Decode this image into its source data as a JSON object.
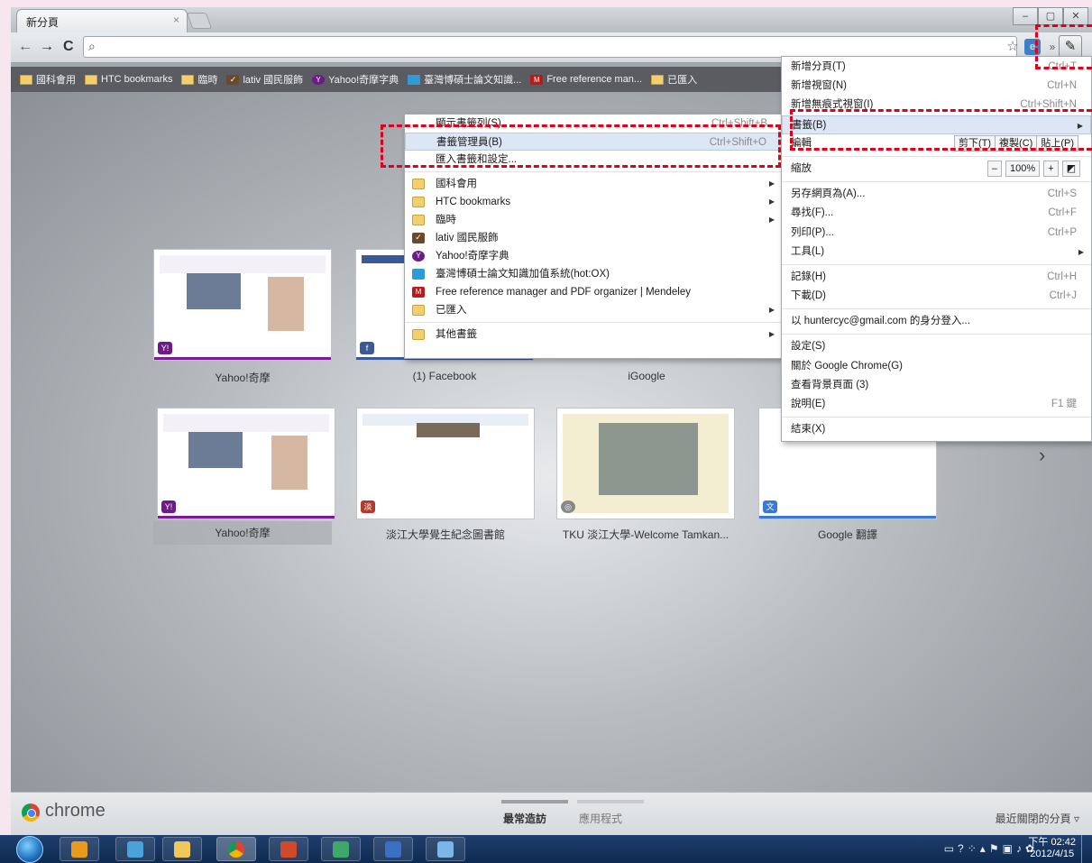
{
  "tab": {
    "title": "新分頁"
  },
  "window_controls": [
    "–",
    "▢",
    "✕"
  ],
  "toolbar": {
    "back_icon": "←",
    "forward_icon": "→",
    "reload_icon": "C",
    "search_icon": "🔍",
    "star_icon": "☆",
    "overflow": "»",
    "wrench_icon": "🔧"
  },
  "bookmarks_bar": [
    {
      "label": "國科會用",
      "icon": "folder"
    },
    {
      "label": "HTC bookmarks",
      "icon": "folder"
    },
    {
      "label": "臨時",
      "icon": "folder"
    },
    {
      "label": "lativ 國民服飾",
      "icon": "check"
    },
    {
      "label": "Yahoo!奇摩字典",
      "icon": "yahoo"
    },
    {
      "label": "臺灣博碩士論文知識...",
      "icon": "thesis"
    },
    {
      "label": "Free reference man...",
      "icon": "mendeley"
    },
    {
      "label": "已匯入",
      "icon": "folder"
    }
  ],
  "thumbnails": {
    "row1": [
      "Yahoo!奇摩",
      "(1) Facebook",
      "iGoogle"
    ],
    "row2": [
      "Yahoo!奇摩",
      "淡江大學覺生紀念圖書館",
      "TKU 淡江大學-Welcome Tamkan...",
      "Google 翻譯"
    ]
  },
  "bottom_bar": {
    "brand": "chrome",
    "most_visited": "最常造訪",
    "apps": "應用程式",
    "recently_closed": "最近關閉的分頁 ▿"
  },
  "bookmarks_submenu": {
    "top": [
      {
        "label": "顯示書籤列(S)",
        "shortcut": "Ctrl+Shift+B"
      },
      {
        "label": "書籤管理員(B)",
        "shortcut": "Ctrl+Shift+O"
      },
      {
        "label": "匯入書籤和設定..."
      }
    ],
    "items": [
      {
        "label": "國科會用",
        "submenu": true,
        "icon": "folder"
      },
      {
        "label": "HTC bookmarks",
        "submenu": true,
        "icon": "folder"
      },
      {
        "label": "臨時",
        "submenu": true,
        "icon": "folder"
      },
      {
        "label": "lativ 國民服飾",
        "icon": "check"
      },
      {
        "label": "Yahoo!奇摩字典",
        "icon": "yahoo"
      },
      {
        "label": "臺灣博碩士論文知識加值系統(hot:OX)",
        "icon": "thesis"
      },
      {
        "label": "Free reference manager and PDF organizer | Mendeley",
        "icon": "mendeley"
      },
      {
        "label": "已匯入",
        "submenu": true,
        "icon": "folder"
      }
    ],
    "other": {
      "label": "其他書籤",
      "submenu": true
    }
  },
  "wrench_menu": {
    "new_tab": {
      "label": "新增分頁(T)",
      "shortcut": "Ctrl+T"
    },
    "new_window": {
      "label": "新增視窗(N)",
      "shortcut": "Ctrl+N"
    },
    "incognito": {
      "label": "新增無痕式視窗(I)",
      "shortcut": "Ctrl+Shift+N"
    },
    "bookmarks": {
      "label": "書籤(B)"
    },
    "edit": {
      "label": "編輯",
      "cut": "剪下(T)",
      "copy": "複製(C)",
      "paste": "貼上(P)"
    },
    "zoom": {
      "label": "縮放",
      "minus": "–",
      "value": "100%",
      "plus": "+"
    },
    "save_as": {
      "label": "另存網頁為(A)...",
      "shortcut": "Ctrl+S"
    },
    "find": {
      "label": "尋找(F)...",
      "shortcut": "Ctrl+F"
    },
    "print": {
      "label": "列印(P)...",
      "shortcut": "Ctrl+P"
    },
    "tools": {
      "label": "工具(L)"
    },
    "history": {
      "label": "記錄(H)",
      "shortcut": "Ctrl+H"
    },
    "downloads": {
      "label": "下載(D)",
      "shortcut": "Ctrl+J"
    },
    "signin": {
      "label": "以 huntercyc@gmail.com 的身分登入..."
    },
    "settings": {
      "label": "設定(S)"
    },
    "about": {
      "label": "關於 Google Chrome(G)"
    },
    "background_pages": {
      "label": "查看背景頁面 (3)"
    },
    "help": {
      "label": "說明(E)",
      "shortcut": "F1 鍵"
    },
    "exit": {
      "label": "結束(X)"
    }
  },
  "taskbar": {
    "clock_time": "下午 02:42",
    "clock_date": "2012/4/15",
    "tray_icons": [
      "keyboard-icon",
      "help-icon",
      "network-icon",
      "flag-icon",
      "monitor-icon",
      "volume-icon",
      "app-icon"
    ]
  },
  "colors": {
    "highlight": "#e0001b",
    "menu_hover": "#dce6f4",
    "yahoo_purple": "#7b1b96"
  }
}
